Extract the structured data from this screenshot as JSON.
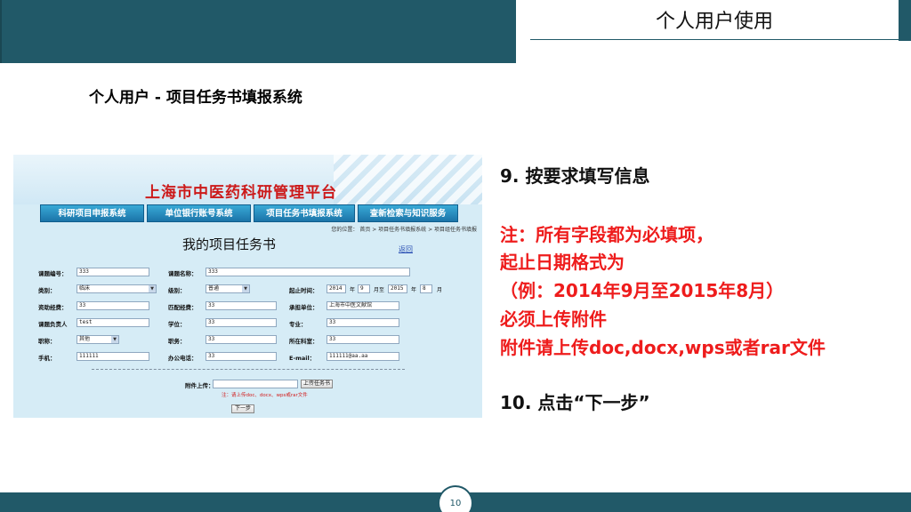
{
  "slide": {
    "title": "个人用户使用",
    "subtitle": "个人用户 - 项目任务书填报系统",
    "page_number": "10",
    "colors": {
      "band": "#215968",
      "accent_red": "#ee1c1c"
    }
  },
  "screenshot": {
    "site_title": "上海市中医药科研管理平台",
    "nav": [
      "科研项目申报系统",
      "单位银行账号系统",
      "项目任务书填报系统",
      "查新检索与知识服务"
    ],
    "breadcrumb": "您的位置： 首页 > 项目任务书填报系统 > 项目组任务书填报",
    "form_title": "我的项目任务书",
    "back_label": "返回",
    "fields": {
      "code_label": "课题编号：",
      "code_value": "333",
      "name_label": "课题名称：",
      "name_value": "333",
      "type_label": "类别：",
      "type_value": "临床",
      "level_label": "级别：",
      "level_value": "普通",
      "period_label": "起止时间：",
      "start_year": "2014",
      "start_month": "9",
      "end_year": "2015",
      "end_month": "8",
      "unit_year": "年",
      "unit_month_to": "月至",
      "unit_month": "月",
      "fund_label": "资助经费：",
      "fund_value": "33",
      "match_label": "匹配经费：",
      "match_value": "33",
      "org_label": "承担单位：",
      "org_value": "上海市中医文献馆",
      "leader_label": "课题负责人",
      "leader_value": "test",
      "degree_label": "学位：",
      "degree_value": "33",
      "major_label": "专业：",
      "major_value": "33",
      "title_label": "职称：",
      "title_value": "其他",
      "post_label": "职务：",
      "post_value": "33",
      "dept_label": "所在科室：",
      "dept_value": "33",
      "phone_label": "手机：",
      "phone_value": "111111",
      "office_label": "办公电话：",
      "office_value": "33",
      "email_label": "E-mail：",
      "email_value": "111111@aa.aa",
      "upload_label": "附件上传：",
      "upload_button": "上传任务书",
      "note": "注：请上传doc、docx、wps或rar文件",
      "next_button": "下一步"
    }
  },
  "instructions": {
    "step9": "9. 按要求填写信息",
    "note1": "注：所有字段都为必填项，",
    "note2": "起止日期格式为",
    "note3": "（例：2014年9月至2015年8月）",
    "note4": "必须上传附件",
    "note5": "附件请上传doc,docx,wps或者rar文件",
    "step10": "10. 点击“下一步”"
  }
}
